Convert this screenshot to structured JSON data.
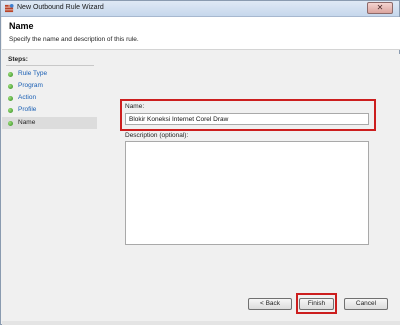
{
  "window": {
    "title": "New Outbound Rule Wizard",
    "close_glyph": "✕"
  },
  "header": {
    "title": "Name",
    "subtitle": "Specify the name and description of this rule."
  },
  "steps": {
    "heading": "Steps:",
    "items": [
      {
        "label": "Rule Type",
        "current": false
      },
      {
        "label": "Program",
        "current": false
      },
      {
        "label": "Action",
        "current": false
      },
      {
        "label": "Profile",
        "current": false
      },
      {
        "label": "Name",
        "current": true
      }
    ]
  },
  "form": {
    "name_label": "Name:",
    "name_value": "Blokir Koneksi Internet Corel Draw",
    "description_label": "Description (optional):",
    "description_value": ""
  },
  "buttons": {
    "back": "< Back",
    "finish": "Finish",
    "cancel": "Cancel"
  },
  "colors": {
    "highlight": "#cc1e1e",
    "link": "#1a5fb4",
    "step_dot": "#2f8a1e"
  }
}
